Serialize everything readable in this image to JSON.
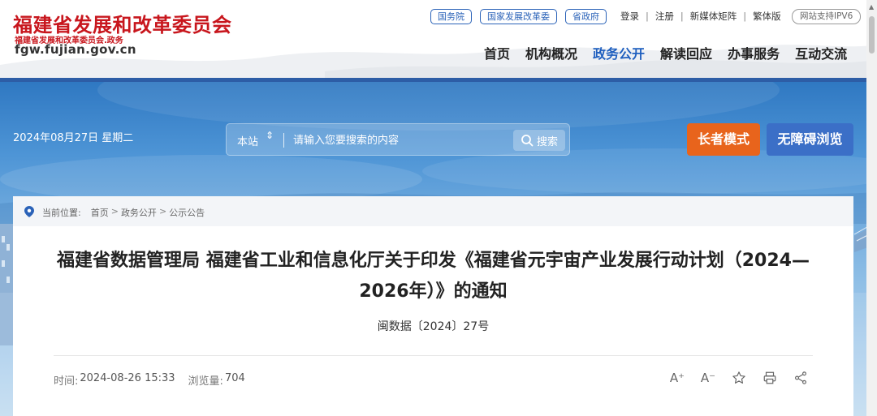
{
  "site": {
    "name": "福建省发展和改革委员会",
    "sub_name": "福建省发展和改革委员会.政务",
    "domain": "fgw.fujian.gov.cn"
  },
  "top_links": [
    "国务院",
    "国家发展改革委",
    "省政府"
  ],
  "user_links": [
    "登录",
    "注册",
    "新媒体矩阵",
    "繁体版"
  ],
  "ipv6_label": "网站支持IPV6",
  "nav": {
    "items": [
      "首页",
      "机构概况",
      "政务公开",
      "解读回应",
      "办事服务",
      "互动交流"
    ],
    "active": "政务公开"
  },
  "banner": {
    "date": "2024年08月27日 星期二",
    "search_scope": "本站",
    "search_placeholder": "请输入您要搜索的内容",
    "search_button": "搜索",
    "elder_mode": "长者模式",
    "accessibility": "无障碍浏览"
  },
  "breadcrumb": {
    "label": "当前位置:",
    "items": [
      "首页",
      "政务公开",
      "公示公告"
    ]
  },
  "article": {
    "title": "福建省数据管理局 福建省工业和信息化厅关于印发《福建省元宇宙产业发展行动计划（2024—2026年）》的通知",
    "doc_number": "闽数据〔2024〕27号",
    "time_label": "时间:",
    "time_value": "2024-08-26 15:33",
    "views_label": "浏览量:",
    "views_value": "704"
  },
  "tools": {
    "font_increase": "A⁺",
    "font_decrease": "A⁻"
  },
  "colors": {
    "brand_red": "#c8161d",
    "nav_active": "#1f5fbf",
    "elder_orange": "#e8641c",
    "access_blue": "#3b6fc7"
  }
}
